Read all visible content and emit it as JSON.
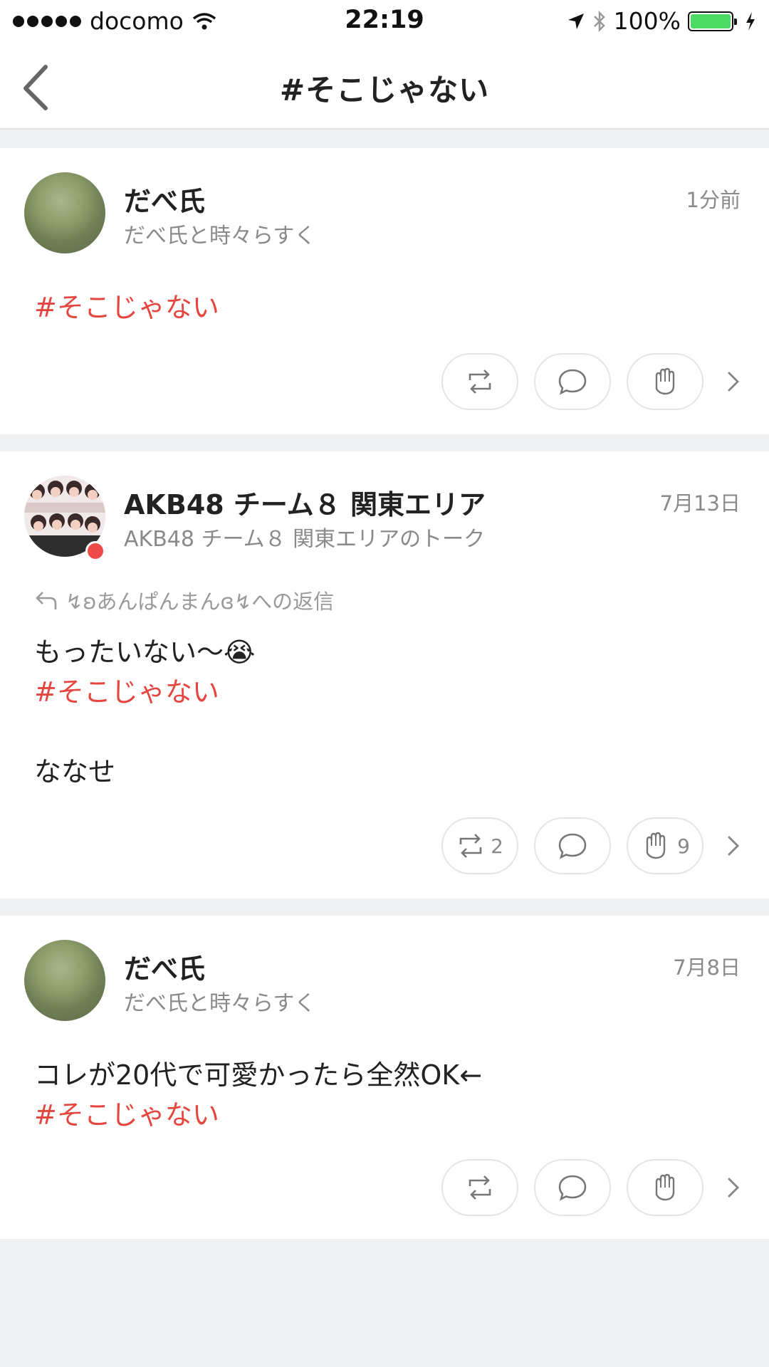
{
  "status_bar": {
    "carrier": "docomo",
    "time": "22:19",
    "battery": "100%"
  },
  "nav": {
    "title": "#そこじゃない"
  },
  "posts": [
    {
      "author": "だべ氏",
      "group": "だべ氏と時々らすく",
      "time": "1分前",
      "lines": [],
      "hashtag": "#そこじゃない",
      "repost_count": "",
      "like_count": ""
    },
    {
      "author": "AKB48 チーム８ 関東エリア",
      "group": "AKB48 チーム８ 関東エリアのトーク",
      "time": "7月13日",
      "reply_to": "↯ʚあんぱんまんɞ↯への返信",
      "line1": "もったいない〜😭",
      "hashtag": "#そこじゃない",
      "line3": "ななせ",
      "repost_count": "2",
      "like_count": "9"
    },
    {
      "author": "だべ氏",
      "group": "だべ氏と時々らすく",
      "time": "7月8日",
      "line1": "コレが20代で可愛かったら全然OK←",
      "hashtag": "#そこじゃない",
      "repost_count": "",
      "like_count": ""
    }
  ],
  "colors": {
    "hashtag": "#e5463f",
    "battery": "#4cd964",
    "background": "#eff0f2"
  }
}
